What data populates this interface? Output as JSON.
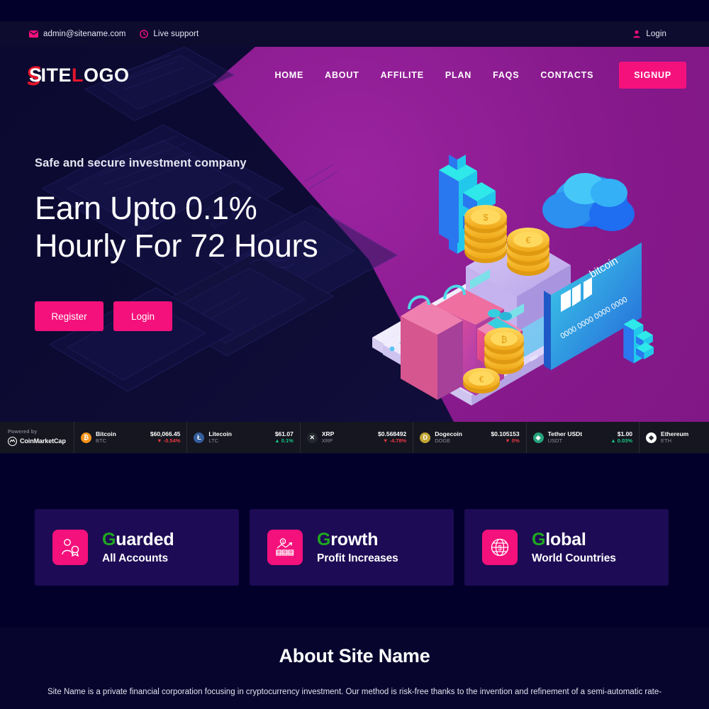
{
  "topbar": {
    "email": "admin@sitename.com",
    "email_icon": "envelope-icon",
    "support": "Live support",
    "support_icon": "clock-icon",
    "login": "Login",
    "login_icon": "user-icon"
  },
  "header": {
    "logo_part1": "S",
    "logo_part2": "ITE",
    "logo_part3": "L",
    "logo_part4": "OGO",
    "logo_full": "SITELOGO",
    "nav": [
      {
        "label": "HOME"
      },
      {
        "label": "ABOUT"
      },
      {
        "label": "AFFILITE"
      },
      {
        "label": "PLAN"
      },
      {
        "label": "FAQS"
      },
      {
        "label": "CONTACTS"
      }
    ],
    "signup": "SIGNUP"
  },
  "hero": {
    "subtitle": "Safe and secure investment company",
    "title_line1": "Earn Upto 0.1%",
    "title_line2": "Hourly For 72 Hours",
    "register": "Register",
    "login": "Login",
    "card_brand": "bitcoin",
    "card_number": "0000 0000 0000 0000"
  },
  "ticker": {
    "powered_by": "Powered by",
    "provider": "CoinMarketCap",
    "provider_icon": "coinmarketcap-icon",
    "coins": [
      {
        "name": "Bitcoin",
        "symbol": "BTC",
        "price": "$60,066.45",
        "change": "-0.54%",
        "dir": "down",
        "color": "#f7931a",
        "glyph": "₿"
      },
      {
        "name": "Litecoin",
        "symbol": "LTC",
        "price": "$61.07",
        "change": "0.1%",
        "dir": "up",
        "color": "#345d9d",
        "glyph": "Ł"
      },
      {
        "name": "XRP",
        "symbol": "XRP",
        "price": "$0.568492",
        "change": "-4.78%",
        "dir": "down",
        "color": "#23292f",
        "glyph": "✕"
      },
      {
        "name": "Dogecoin",
        "symbol": "DOGE",
        "price": "$0.105153",
        "change": "0%",
        "dir": "down",
        "color": "#c3a634",
        "glyph": "D"
      },
      {
        "name": "Tether USDt",
        "symbol": "USDT",
        "price": "$1.00",
        "change": "0.03%",
        "dir": "up",
        "color": "#26a17b",
        "glyph": "❖"
      },
      {
        "name": "Ethereum",
        "symbol": "ETH",
        "price": "",
        "change": "",
        "dir": "up",
        "color": "#ffffff",
        "glyph": "◆"
      }
    ]
  },
  "features": [
    {
      "initial": "G",
      "title_rest": "uarded",
      "subtitle": "All Accounts",
      "icon": "user-badge-icon"
    },
    {
      "initial": "G",
      "title_rest": "rowth",
      "subtitle": "Profit Increases",
      "icon": "growth-chart-icon"
    },
    {
      "initial": "G",
      "title_rest": "lobal",
      "subtitle": "World Countries",
      "icon": "globe-dollar-icon"
    }
  ],
  "about": {
    "title": "About Site Name",
    "text": "Site Name is a private financial corporation focusing in cryptocurrency investment. Our method is risk-free thanks to the invention and refinement of a semi-automatic rate-"
  },
  "colors": {
    "accent_pink": "#f5117b",
    "purple": "#8c1d8f",
    "navy": "#02002b",
    "card": "#1d0b55",
    "green": "#1fa81f",
    "up": "#16c784",
    "down": "#ea3943"
  }
}
